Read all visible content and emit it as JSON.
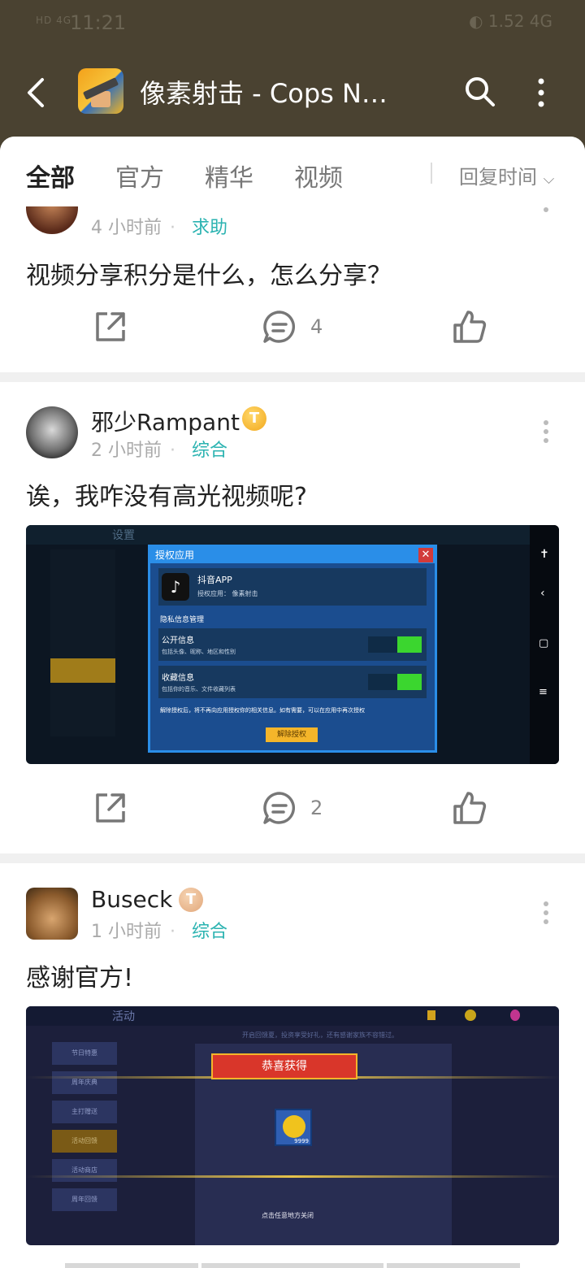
{
  "status_bar": {
    "signal": "HD 4G",
    "time": "11:21",
    "right": "◐ 1.52  4G"
  },
  "app_bar": {
    "title": "像素射击 - Cops N…"
  },
  "tabs": [
    {
      "label": "全部"
    },
    {
      "label": "官方"
    },
    {
      "label": "精华"
    },
    {
      "label": "视频"
    }
  ],
  "sort_label": "回复时间",
  "posts": [
    {
      "time": "4 小时前",
      "category": "求助",
      "text": "视频分享积分是什么，怎么分享？",
      "comments": "4"
    },
    {
      "username": "邪少Rampant",
      "badge": "T",
      "time": "2 小时前",
      "category": "综合",
      "text": "诶，我咋没有高光视频呢?",
      "comments": "2",
      "image": {
        "header_left": "设置",
        "dialog_title": "授权应用",
        "app_name": "抖音APP",
        "app_sub": "授权应用：  像素射击",
        "section": "隐私信息管理",
        "row1_title": "公开信息",
        "row1_sub": "包括头像、昵称、地区和性别",
        "row2_title": "收藏信息",
        "row2_sub": "包括你的音乐、文件收藏列表",
        "notice": "解除授权后，将不再向应用授权你的相关信息。如有需要，可以在应用中再次授权",
        "button": "解除授权"
      }
    },
    {
      "username": "Buseck",
      "badge": "T",
      "time": "1 小时前",
      "category": "综合",
      "text": "感谢官方!",
      "image": {
        "header_left": "活动",
        "banner": "恭喜获得",
        "item_count": "9999",
        "hint": "点击任意地方关闭",
        "top_note": "开启回馈夏，投资享受好礼，还有感谢家族不容错过。",
        "side_items": [
          "节日特惠",
          "周年庆典",
          "主打赠送",
          "活动回馈",
          "活动商店",
          "周年回馈"
        ]
      }
    }
  ]
}
